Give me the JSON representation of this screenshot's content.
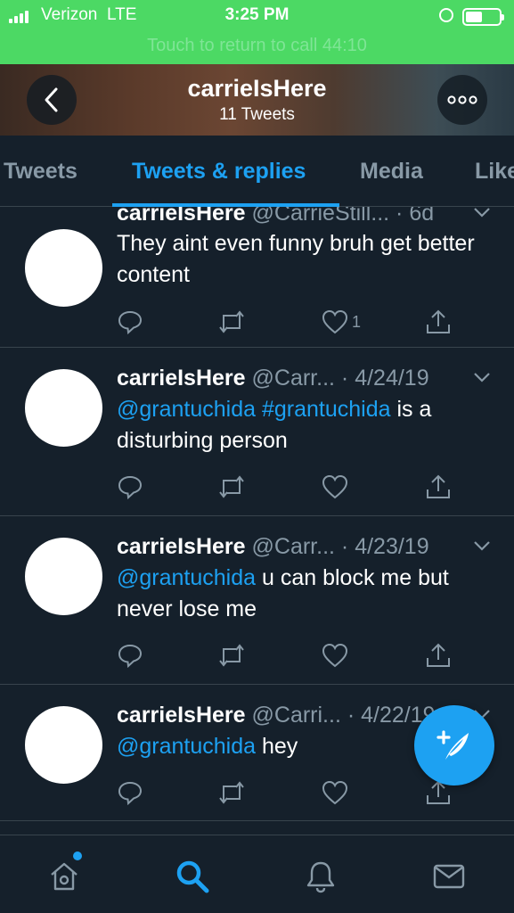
{
  "status_bar": {
    "carrier": "Verizon",
    "network": "LTE",
    "time": "3:25 PM",
    "call_banner": "Touch to return to call 44:10",
    "battery_level": 0.5
  },
  "header": {
    "title": "carrieIsHere",
    "subtitle": "11 Tweets"
  },
  "tabs": [
    {
      "label": "Tweets",
      "active": false
    },
    {
      "label": "Tweets & replies",
      "active": true
    },
    {
      "label": "Media",
      "active": false
    },
    {
      "label": "Likes",
      "active": false
    }
  ],
  "tweets": [
    {
      "name": "carrieIsHere",
      "handle": "@CarrieStill...",
      "date": "· 6d",
      "text_mention": "",
      "text_hashtag": "",
      "text": "They aint even funny bruh get better content",
      "likes": "1"
    },
    {
      "name": "carrieIsHere",
      "handle": "@Carr...",
      "date": "· 4/24/19",
      "text_mention": "@grantuchida",
      "text_hashtag": "#grantuchida",
      "text": "is a disturbing person",
      "likes": ""
    },
    {
      "name": "carrieIsHere",
      "handle": "@Carr...",
      "date": "· 4/23/19",
      "text_mention": "@grantuchida",
      "text_hashtag": "",
      "text": "u can block me but never lose me",
      "likes": ""
    },
    {
      "name": "carrieIsHere",
      "handle": "@Carri...",
      "date": "· 4/22/19",
      "text_mention": "@grantuchida",
      "text_hashtag": "",
      "text": "hey",
      "likes": ""
    }
  ],
  "colors": {
    "status_green": "#4cd964",
    "background": "#15202b",
    "accent": "#1da1f2",
    "muted": "#8899a6"
  },
  "icons": {
    "reply": "reply-icon",
    "retweet": "retweet-icon",
    "like": "heart-icon",
    "share": "share-icon",
    "home": "home-icon",
    "search": "search-icon",
    "notifications": "bell-icon",
    "messages": "mail-icon",
    "compose": "compose-tweet-icon"
  }
}
